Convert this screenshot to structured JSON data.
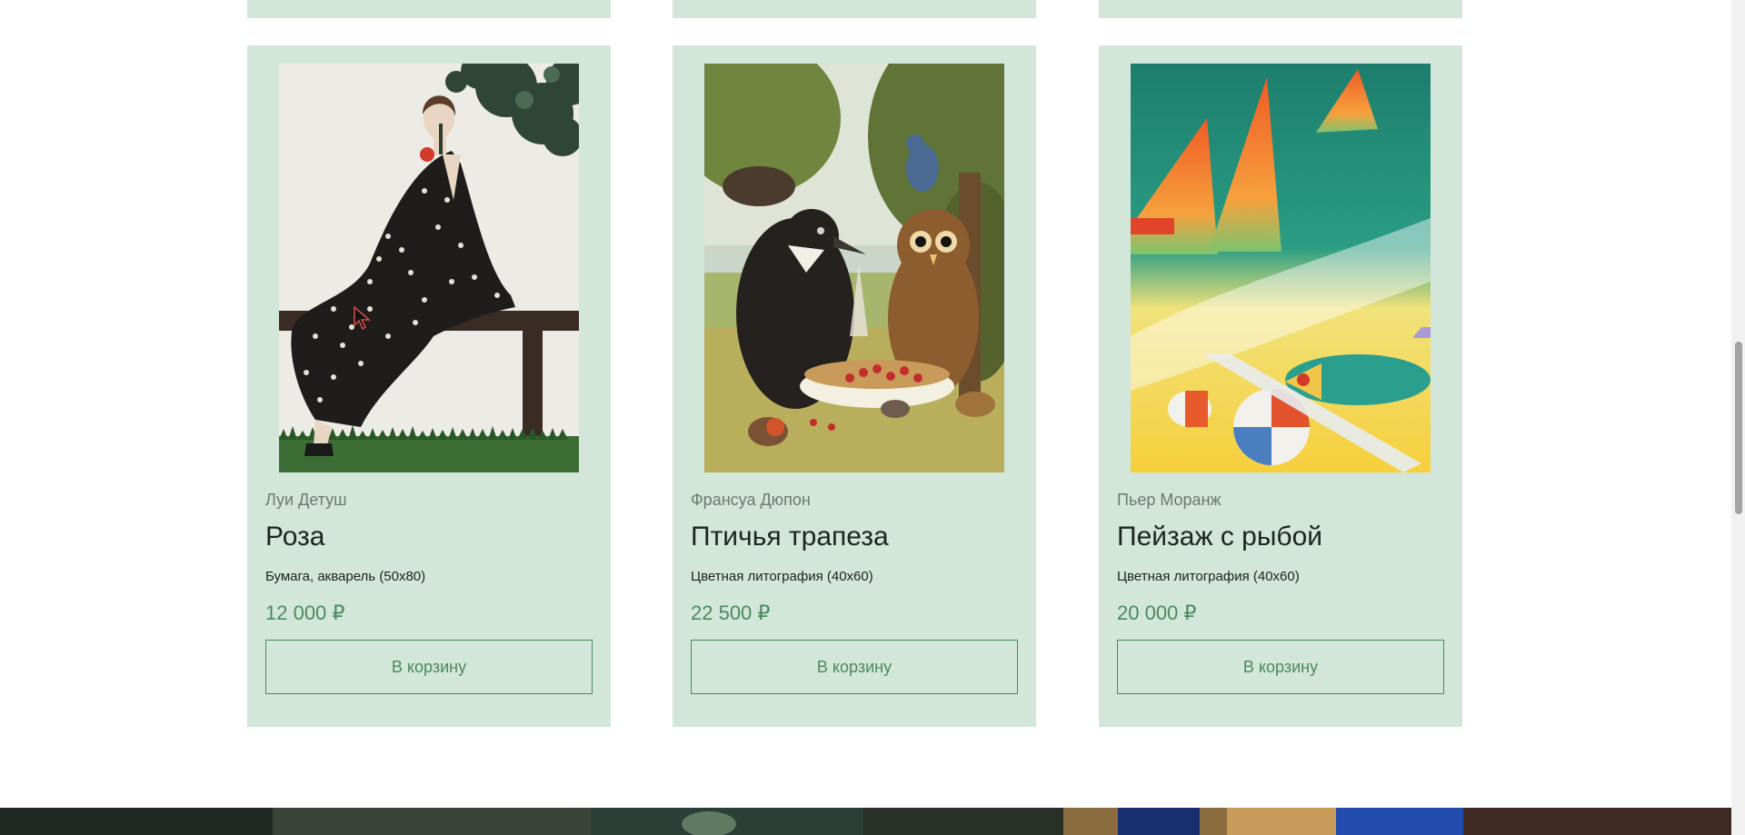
{
  "products": [
    {
      "author": "Луи Детуш",
      "title": "Роза",
      "details": "Бумага, акварель (50x80)",
      "price": "12 000 ₽",
      "button_label": "В корзину"
    },
    {
      "author": "Франсуа Дюпон",
      "title": "Птичья трапеза",
      "details": "Цветная литография (40x60)",
      "price": "22 500 ₽",
      "button_label": "В корзину"
    },
    {
      "author": "Пьер Моранж",
      "title": "Пейзаж с рыбой",
      "details": "Цветная литография (40x60)",
      "price": "20 000 ₽",
      "button_label": "В корзину"
    }
  ],
  "colors": {
    "card_background": "#d2e6d9",
    "accent": "#4b8a5f",
    "author_text": "#6d7a71",
    "title_text": "#1d2421"
  }
}
